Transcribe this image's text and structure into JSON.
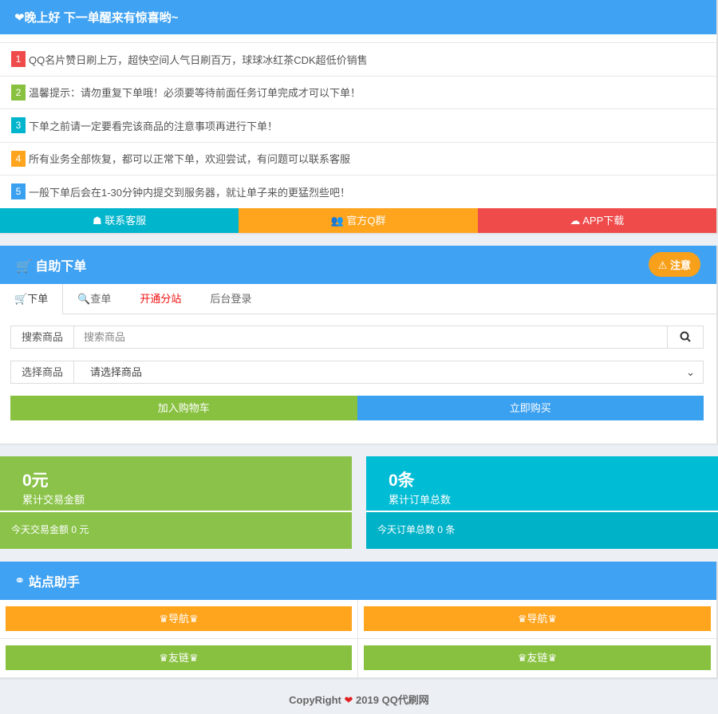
{
  "colors": {
    "blue": "#40a2f2",
    "red": "#ef4b4b",
    "green": "#88c140",
    "cyan": "#00b5cc",
    "orange": "#ffa41d",
    "lblue": "#3aa0f0"
  },
  "top": {
    "title": "❤晚上好 下一单醒来有惊喜哟~",
    "notices": [
      {
        "n": "1",
        "text": "QQ名片赞日刷上万，超快空间人气日刷百万，球球冰红茶CDK超低价销售",
        "color": "#ef4b4b"
      },
      {
        "n": "2",
        "text": "温馨提示：请勿重复下单哦！必须要等待前面任务订单完成才可以下单！",
        "color": "#88c140"
      },
      {
        "n": "3",
        "text": "下单之前请一定要看完该商品的注意事项再进行下单！",
        "color": "#00b5cc"
      },
      {
        "n": "4",
        "text": "所有业务全部恢复，都可以正常下单，欢迎尝试，有问题可以联系客服",
        "color": "#ffa41d"
      },
      {
        "n": "5",
        "text": "一般下单后会在1-30分钟内提交到服务器，就让单子来的更猛烈些吧！",
        "color": "#3aa0f0"
      }
    ],
    "buttons": [
      "联系客服",
      "官方Q群",
      "APP下载"
    ]
  },
  "order": {
    "title": "自助下单",
    "notice_btn": "注意",
    "tabs": [
      "下单",
      "查单",
      "开通分站",
      "后台登录"
    ],
    "search_label": "搜索商品",
    "search_placeholder": "搜索商品",
    "select_label": "选择商品",
    "select_value": "请选择商品",
    "add_cart": "加入购物车",
    "buy_now": "立即购买"
  },
  "stats": [
    {
      "value": "0元",
      "label": "累计交易金额",
      "today": "今天交易金额 0 元"
    },
    {
      "value": "0条",
      "label": "累计订单总数",
      "today": "今天订单总数 0 条"
    }
  ],
  "helper": {
    "title": "站点助手",
    "items": [
      "♛导航♛",
      "♛导航♛",
      "♛友链♛",
      "♛友链♛"
    ]
  },
  "footer": {
    "pre": "CopyRight",
    "heart": "❤",
    "post": "2019 QQ代刷网"
  }
}
